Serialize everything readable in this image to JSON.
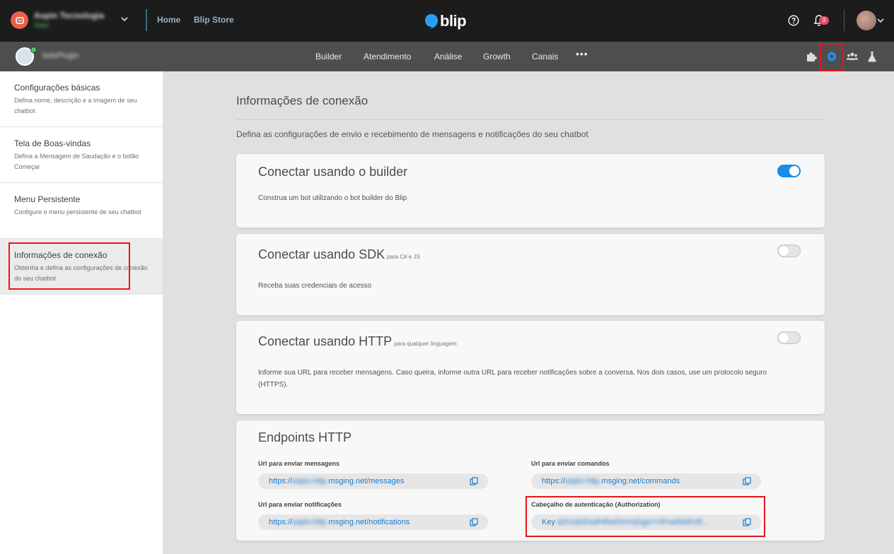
{
  "topbar": {
    "org_name": "Aspin Tecnologia",
    "org_plan": "Start",
    "nav": [
      "Home",
      "Blip Store"
    ],
    "brand": "blip",
    "notifications_count": "3"
  },
  "subbar": {
    "bot_name": "botsPlugin",
    "nav": [
      "Builder",
      "Atendimento",
      "Análise",
      "Growth",
      "Canais"
    ],
    "more": "•••"
  },
  "sidebar": {
    "items": [
      {
        "title": "Configurações básicas",
        "desc": "Defina nome, descrição e a imagem de seu chatbot"
      },
      {
        "title": "Tela de Boas-vindas",
        "desc": "Defina a Mensagem de Saudação e o botão Começar"
      },
      {
        "title": "Menu Persistente",
        "desc": "Configure o menu persistente de seu chatbot"
      },
      {
        "title": "Informações de conexão",
        "desc": "Obtenha e defina as configurações de conexão do seu chatbot"
      }
    ]
  },
  "main": {
    "title": "Informações de conexão",
    "subtitle": "Defina as configurações de envio e recebimento de mensagens e notificações do seu chatbot",
    "cards": [
      {
        "title": "Conectar usando o builder",
        "note": "",
        "text": "Construa um bot utilizando o bot builder do Blip",
        "enabled": true
      },
      {
        "title": "Conectar usando SDK",
        "note": "para C# e JS",
        "text": "Receba suas credenciais de acesso",
        "enabled": false
      },
      {
        "title": "Conectar usando HTTP",
        "note": "para qualquer linguagem",
        "text": "Informe sua URL para receber mensagens. Caso queira, informe outra URL para receber notificações sobre a conversa. Nos dois casos, use um protocolo seguro (HTTPS).",
        "enabled": false
      }
    ],
    "endpoints": {
      "title": "Endpoints HTTP",
      "fields": [
        {
          "label": "Url para enviar mensagens",
          "prefix": "https://",
          "hidden": "aspin-http.",
          "suffix": "msging.net/messages"
        },
        {
          "label": "Url para enviar comandos",
          "prefix": "https://",
          "hidden": "aspin-http.",
          "suffix": "msging.net/commands"
        },
        {
          "label": "Url para enviar notificações",
          "prefix": "https://",
          "hidden": "aspin-http.",
          "suffix": "msging.net/notifications"
        },
        {
          "label": "Cabeçalho de autenticação (Authorization)",
          "prefix": "Key ",
          "hidden": "d2VzdGhsdHRwOmVqSgzrY0Fva0tIdHJ5...",
          "suffix": ""
        }
      ]
    }
  },
  "colors": {
    "accent": "#1a8ce6",
    "highlight": "#e5161b",
    "topbar": "#1c1c1c",
    "subbar": "#4e4e4e"
  },
  "icons": [
    "org-logo-icon",
    "chevron-down-icon",
    "help-icon",
    "bell-icon",
    "puzzle-icon",
    "gear-icon",
    "users-icon",
    "flask-icon",
    "copy-icon"
  ]
}
